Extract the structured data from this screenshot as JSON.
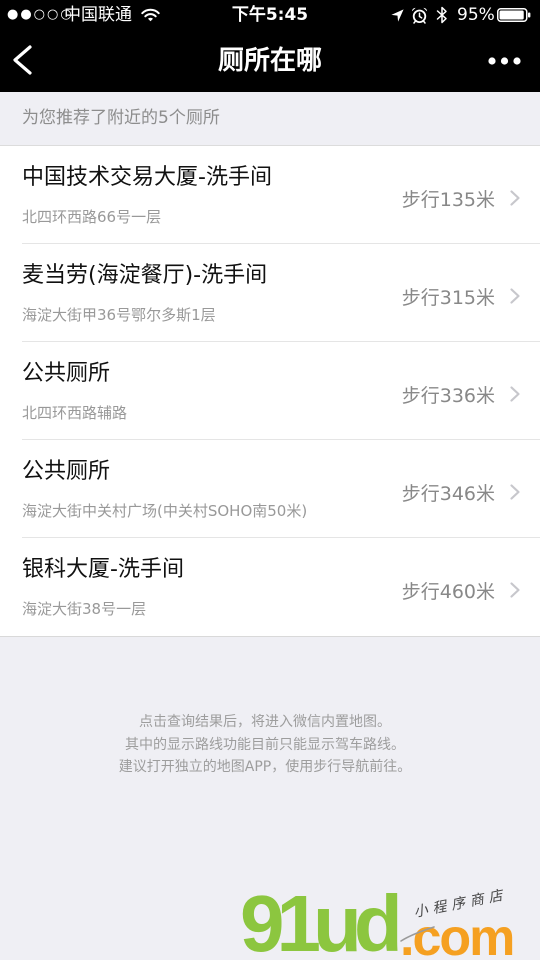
{
  "status_bar": {
    "signal": "●●○○○",
    "carrier": "中国联通",
    "time": "下午5:45",
    "battery_text": "95%",
    "battery_level": 0.95,
    "icons": {
      "wifi": "wifi-icon",
      "location": "location-arrow-icon",
      "alarm": "alarm-clock-icon",
      "bluetooth": "bluetooth-icon",
      "battery": "battery-icon"
    }
  },
  "nav": {
    "title": "厕所在哪",
    "back_icon": "chevron-left-icon",
    "more_icon": "more-dots-icon"
  },
  "section_header": "为您推荐了附近的5个厕所",
  "results": [
    {
      "name": "中国技术交易大厦-洗手间",
      "address": "北四环西路66号一层",
      "distance": "步行135米"
    },
    {
      "name": "麦当劳(海淀餐厅)-洗手间",
      "address": "海淀大街甲36号鄂尔多斯1层",
      "distance": "步行315米"
    },
    {
      "name": "公共厕所",
      "address": "北四环西路辅路",
      "distance": "步行336米"
    },
    {
      "name": "公共厕所",
      "address": "海淀大街中关村广场(中关村SOHO南50米)",
      "distance": "步行346米"
    },
    {
      "name": "银科大厦-洗手间",
      "address": "海淀大街38号一层",
      "distance": "步行460米"
    }
  ],
  "row_icon": "chevron-right-icon",
  "footer_note": [
    "点击查询结果后，将进入微信内置地图。",
    "其中的显示路线功能目前只能显示驾车路线。",
    "建议打开独立的地图APP，使用步行导航前往。"
  ],
  "watermark": {
    "brand": "91ud",
    "domain": ".com",
    "tagline": "小程序商店"
  },
  "colors": {
    "bar_bg": "#000000",
    "page_bg": "#efeff4",
    "card_bg": "#ffffff",
    "title_text": "#111111",
    "secondary_text": "#999999",
    "distance_text": "#888888",
    "divider": "#e5e5e5",
    "chevron": "#c7c7cc",
    "watermark_green": "#8cc63f",
    "watermark_orange": "#f5a021"
  }
}
